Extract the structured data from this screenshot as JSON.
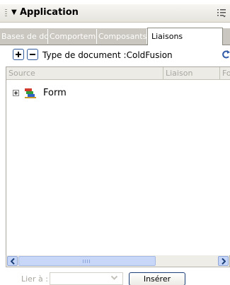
{
  "window": {
    "title": "Application"
  },
  "tabs": [
    {
      "label": "Bases de dc",
      "active": false
    },
    {
      "label": "Comportem",
      "active": false
    },
    {
      "label": "Composants",
      "active": false
    },
    {
      "label": "Liaisons",
      "active": true
    }
  ],
  "toolbar": {
    "add_icon": "plus-icon",
    "remove_icon": "minus-icon",
    "doctype_label": "Type de document :ColdFusion",
    "refresh_icon": "refresh-icon"
  },
  "table": {
    "columns": [
      "Source",
      "Liaison",
      "Fo"
    ],
    "rows": [
      {
        "label": "Form",
        "icon": "form-icon",
        "expanded": false
      }
    ]
  },
  "footer": {
    "bind_label": "Lier à :",
    "bind_value": "",
    "insert_label": "Insérer"
  },
  "colors": {
    "tab_bar": "#c9c7bf",
    "scrollbar_button": "#c5d5f7",
    "button_border": "#1c3f7a"
  }
}
